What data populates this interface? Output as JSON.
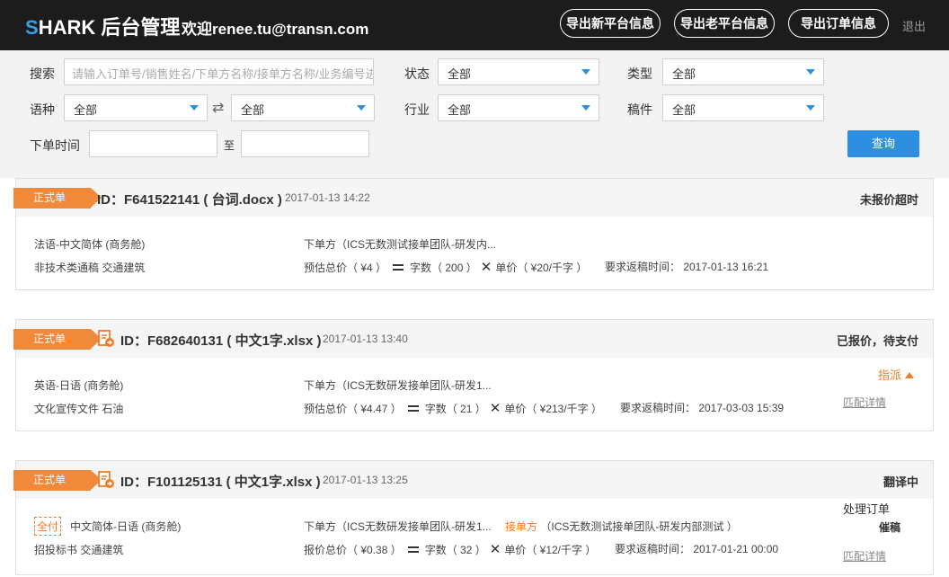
{
  "header": {
    "logo_s": "S",
    "logo_rest": "HARK 后台管理",
    "welcome": "欢迎renee.tu@transn.com",
    "buttons": [
      "导出新平台信息",
      "导出老平台信息",
      "导出订单信息"
    ],
    "logout": "退出"
  },
  "filter": {
    "search_label": "搜索",
    "search_placeholder": "请输入订单号/销售姓名/下单方名称/接单方名称/业务编号进行",
    "status_label": "状态",
    "status_value": "全部",
    "type_label": "类型",
    "type_value": "全部",
    "lang_label": "语种",
    "lang_from": "全部",
    "lang_to": "全部",
    "industry_label": "行业",
    "industry_value": "全部",
    "doc_label": "稿件",
    "doc_value": "全部",
    "date_label": "下单时间",
    "date_to_label": "至",
    "query_button": "查询"
  },
  "orders": [
    {
      "tag": "正式单",
      "id": "ID：F641522141",
      "file": "( 台词.docx )",
      "time": "2017-01-13 14:22",
      "status": "未报价超时",
      "lang": "法语-中文简体 (商务舱)",
      "category": "非技术类通稿  交通建筑",
      "client": "下单方（ICS无数测试接单团队-研发内...",
      "price_label": "预估总价（ ¥4 ）",
      "words": "字数（ 200 ）",
      "unit": "单价（ ¥20/千字 ）",
      "deadline": "要求返稿时间： 2017-01-13 16:21"
    },
    {
      "tag": "正式单",
      "id": "ID：F682640131",
      "file": "( 中文1字.xlsx )",
      "time": "2017-01-13 13:40",
      "status": "已报价，待支付",
      "lang": "英语-日语 (商务舱)",
      "category": "文化宣传文件  石油",
      "client": "下单方（ICS无数研发接单团队-研发1...",
      "price_label": "预估总价（ ¥4.47 ）",
      "words": "字数（ 21 ）",
      "unit": "单价（ ¥213/千字 ）",
      "deadline": "要求返稿时间： 2017-03-03 15:39",
      "assign": "指派",
      "match": "匹配详情"
    },
    {
      "tag": "正式单",
      "id": "ID：F101125131",
      "file": "( 中文1字.xlsx )",
      "time": "2017-01-13 13:25",
      "status": "翻译中",
      "badge": "全付",
      "lang": "中文简体-日语 (商务舱)",
      "category": "招投标书  交通建筑",
      "client": "下单方（ICS无数研发接单团队-研发1...",
      "receiver_label": "接单方",
      "receiver": "（ICS无数测试接单团队-研发内部测试 ）",
      "price_label": "报价总价（ ¥0.38 ）",
      "words": "字数（ 32 ）",
      "unit": "单价（ ¥12/千字 ）",
      "deadline": "要求返稿时间： 2017-01-21 00:00",
      "process": "处理订单",
      "urge": "催稿",
      "match": "匹配详情"
    }
  ],
  "colors": {
    "accent": "#2e8fe0",
    "tag": "#f08a3a",
    "header": "#1c1c1c"
  }
}
